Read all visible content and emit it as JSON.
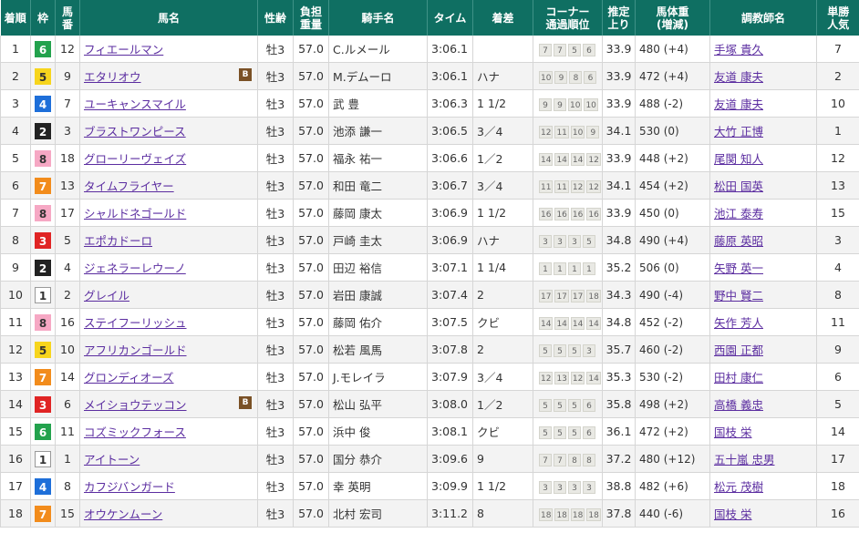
{
  "headers": {
    "rank": "着順",
    "waku": "枠",
    "umaban_1": "馬",
    "umaban_2": "番",
    "horse": "馬名",
    "sexage": "性齢",
    "weight_1": "負担",
    "weight_2": "重量",
    "jockey": "騎手名",
    "time": "タイム",
    "margin": "着差",
    "corner_1": "コーナー",
    "corner_2": "通過順位",
    "last3f_1": "推定",
    "last3f_2": "上り",
    "body_1": "馬体重",
    "body_2": "(増減)",
    "trainer": "調教師名",
    "pop_1": "単勝",
    "pop_2": "人気"
  },
  "waku_colors": {
    "1": {
      "bg": "#ffffff",
      "fg": "#333333",
      "border": "#999999"
    },
    "2": {
      "bg": "#222222",
      "fg": "#ffffff",
      "border": "#222222"
    },
    "3": {
      "bg": "#e02424",
      "fg": "#ffffff",
      "border": "#e02424"
    },
    "4": {
      "bg": "#1e6fd9",
      "fg": "#ffffff",
      "border": "#1e6fd9"
    },
    "5": {
      "bg": "#f7d51d",
      "fg": "#333333",
      "border": "#f7d51d"
    },
    "6": {
      "bg": "#23a24d",
      "fg": "#ffffff",
      "border": "#23a24d"
    },
    "7": {
      "bg": "#f28c1c",
      "fg": "#ffffff",
      "border": "#f28c1c"
    },
    "8": {
      "bg": "#f6a8c4",
      "fg": "#333333",
      "border": "#f6a8c4"
    }
  },
  "rows": [
    {
      "rank": "1",
      "waku": "6",
      "umaban": "12",
      "horse": "フィエールマン",
      "blinker": "",
      "sexage": "牡3",
      "weight": "57.0",
      "jockey": "C.ルメール",
      "jockey_link": true,
      "time": "3:06.1",
      "margin": "",
      "corners": [
        "7",
        "7",
        "5",
        "6"
      ],
      "last3f": "33.9",
      "body": "480 (+4)",
      "trainer": "手塚 貴久",
      "pop": "7"
    },
    {
      "rank": "2",
      "waku": "5",
      "umaban": "9",
      "horse": "エタリオウ",
      "blinker": "B",
      "sexage": "牡3",
      "weight": "57.0",
      "jockey": "M.デムーロ",
      "jockey_link": true,
      "time": "3:06.1",
      "margin": "ハナ",
      "corners": [
        "10",
        "9",
        "8",
        "6"
      ],
      "last3f": "33.9",
      "body": "472 (+4)",
      "trainer": "友道 康夫",
      "pop": "2"
    },
    {
      "rank": "3",
      "waku": "4",
      "umaban": "7",
      "horse": "ユーキャンスマイル",
      "blinker": "",
      "sexage": "牡3",
      "weight": "57.0",
      "jockey": "武 豊",
      "jockey_link": true,
      "time": "3:06.3",
      "margin": "1 1/2",
      "corners": [
        "9",
        "9",
        "10",
        "10"
      ],
      "last3f": "33.9",
      "body": "488 (-2)",
      "trainer": "友道 康夫",
      "pop": "10"
    },
    {
      "rank": "4",
      "waku": "2",
      "umaban": "3",
      "horse": "ブラストワンピース",
      "blinker": "",
      "sexage": "牡3",
      "weight": "57.0",
      "jockey": "池添 謙一",
      "jockey_link": true,
      "time": "3:06.5",
      "margin": "3／4",
      "corners": [
        "12",
        "11",
        "10",
        "9"
      ],
      "last3f": "34.1",
      "body": "530 (0)",
      "trainer": "大竹 正博",
      "pop": "1"
    },
    {
      "rank": "5",
      "waku": "8",
      "umaban": "18",
      "horse": "グローリーヴェイズ",
      "blinker": "",
      "sexage": "牡3",
      "weight": "57.0",
      "jockey": "福永 祐一",
      "jockey_link": true,
      "time": "3:06.6",
      "margin": "1／2",
      "corners": [
        "14",
        "14",
        "14",
        "12"
      ],
      "last3f": "33.9",
      "body": "448 (+2)",
      "trainer": "尾関 知人",
      "pop": "12"
    },
    {
      "rank": "6",
      "waku": "7",
      "umaban": "13",
      "horse": "タイムフライヤー",
      "blinker": "",
      "sexage": "牡3",
      "weight": "57.0",
      "jockey": "和田 竜二",
      "jockey_link": true,
      "time": "3:06.7",
      "margin": "3／4",
      "corners": [
        "11",
        "11",
        "12",
        "12"
      ],
      "last3f": "34.1",
      "body": "454 (+2)",
      "trainer": "松田 国英",
      "pop": "13"
    },
    {
      "rank": "7",
      "waku": "8",
      "umaban": "17",
      "horse": "シャルドネゴールド",
      "blinker": "",
      "sexage": "牡3",
      "weight": "57.0",
      "jockey": "藤岡 康太",
      "jockey_link": true,
      "time": "3:06.9",
      "margin": "1 1/2",
      "corners": [
        "16",
        "16",
        "16",
        "16"
      ],
      "last3f": "33.9",
      "body": "450 (0)",
      "trainer": "池江 泰寿",
      "pop": "15"
    },
    {
      "rank": "8",
      "waku": "3",
      "umaban": "5",
      "horse": "エポカドーロ",
      "blinker": "",
      "sexage": "牡3",
      "weight": "57.0",
      "jockey": "戸崎 圭太",
      "jockey_link": true,
      "time": "3:06.9",
      "margin": "ハナ",
      "corners": [
        "3",
        "3",
        "3",
        "5"
      ],
      "last3f": "34.8",
      "body": "490 (+4)",
      "trainer": "藤原 英昭",
      "pop": "3"
    },
    {
      "rank": "9",
      "waku": "2",
      "umaban": "4",
      "horse": "ジェネラーレウーノ",
      "blinker": "",
      "sexage": "牡3",
      "weight": "57.0",
      "jockey": "田辺 裕信",
      "jockey_link": true,
      "time": "3:07.1",
      "margin": "1 1/4",
      "corners": [
        "1",
        "1",
        "1",
        "1"
      ],
      "last3f": "35.2",
      "body": "506 (0)",
      "trainer": "矢野 英一",
      "pop": "4"
    },
    {
      "rank": "10",
      "waku": "1",
      "umaban": "2",
      "horse": "グレイル",
      "blinker": "",
      "sexage": "牡3",
      "weight": "57.0",
      "jockey": "岩田 康誠",
      "jockey_link": true,
      "time": "3:07.4",
      "margin": "2",
      "corners": [
        "17",
        "17",
        "17",
        "18"
      ],
      "last3f": "34.3",
      "body": "490 (-4)",
      "trainer": "野中 賢二",
      "pop": "8"
    },
    {
      "rank": "11",
      "waku": "8",
      "umaban": "16",
      "horse": "ステイフーリッシュ",
      "blinker": "",
      "sexage": "牡3",
      "weight": "57.0",
      "jockey": "藤岡 佑介",
      "jockey_link": true,
      "time": "3:07.5",
      "margin": "クビ",
      "corners": [
        "14",
        "14",
        "14",
        "14"
      ],
      "last3f": "34.8",
      "body": "452 (-2)",
      "trainer": "矢作 芳人",
      "pop": "11"
    },
    {
      "rank": "12",
      "waku": "5",
      "umaban": "10",
      "horse": "アフリカンゴールド",
      "blinker": "",
      "sexage": "牡3",
      "weight": "57.0",
      "jockey": "松若 風馬",
      "jockey_link": true,
      "time": "3:07.8",
      "margin": "2",
      "corners": [
        "5",
        "5",
        "5",
        "3"
      ],
      "last3f": "35.7",
      "body": "460 (-2)",
      "trainer": "西園 正都",
      "pop": "9"
    },
    {
      "rank": "13",
      "waku": "7",
      "umaban": "14",
      "horse": "グロンディオーズ",
      "blinker": "",
      "sexage": "牡3",
      "weight": "57.0",
      "jockey": "J.モレイラ",
      "jockey_link": false,
      "time": "3:07.9",
      "margin": "3／4",
      "corners": [
        "12",
        "13",
        "12",
        "14"
      ],
      "last3f": "35.3",
      "body": "530 (-2)",
      "trainer": "田村 康仁",
      "pop": "6"
    },
    {
      "rank": "14",
      "waku": "3",
      "umaban": "6",
      "horse": "メイショウテッコン",
      "blinker": "B",
      "sexage": "牡3",
      "weight": "57.0",
      "jockey": "松山 弘平",
      "jockey_link": true,
      "time": "3:08.0",
      "margin": "1／2",
      "corners": [
        "5",
        "5",
        "5",
        "6"
      ],
      "last3f": "35.8",
      "body": "498 (+2)",
      "trainer": "高橋 義忠",
      "pop": "5"
    },
    {
      "rank": "15",
      "waku": "6",
      "umaban": "11",
      "horse": "コズミックフォース",
      "blinker": "",
      "sexage": "牡3",
      "weight": "57.0",
      "jockey": "浜中 俊",
      "jockey_link": true,
      "time": "3:08.1",
      "margin": "クビ",
      "corners": [
        "5",
        "5",
        "5",
        "6"
      ],
      "last3f": "36.1",
      "body": "472 (+2)",
      "trainer": "国枝 栄",
      "pop": "14"
    },
    {
      "rank": "16",
      "waku": "1",
      "umaban": "1",
      "horse": "アイトーン",
      "blinker": "",
      "sexage": "牡3",
      "weight": "57.0",
      "jockey": "国分 恭介",
      "jockey_link": true,
      "time": "3:09.6",
      "margin": "9",
      "corners": [
        "7",
        "7",
        "8",
        "8"
      ],
      "last3f": "37.2",
      "body": "480 (+12)",
      "trainer": "五十嵐 忠男",
      "pop": "17"
    },
    {
      "rank": "17",
      "waku": "4",
      "umaban": "8",
      "horse": "カフジバンガード",
      "blinker": "",
      "sexage": "牡3",
      "weight": "57.0",
      "jockey": "幸 英明",
      "jockey_link": true,
      "time": "3:09.9",
      "margin": "1 1/2",
      "corners": [
        "3",
        "3",
        "3",
        "3"
      ],
      "last3f": "38.8",
      "body": "482 (+6)",
      "trainer": "松元 茂樹",
      "pop": "18"
    },
    {
      "rank": "18",
      "waku": "7",
      "umaban": "15",
      "horse": "オウケンムーン",
      "blinker": "",
      "sexage": "牡3",
      "weight": "57.0",
      "jockey": "北村 宏司",
      "jockey_link": true,
      "time": "3:11.2",
      "margin": "8",
      "corners": [
        "18",
        "18",
        "18",
        "18"
      ],
      "last3f": "37.8",
      "body": "440 (-6)",
      "trainer": "国枝 栄",
      "pop": "16"
    }
  ]
}
